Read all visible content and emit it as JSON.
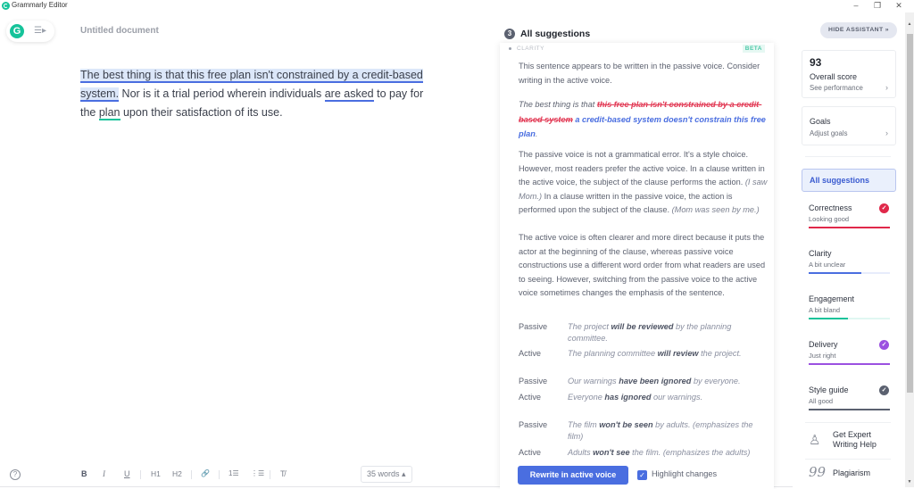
{
  "window": {
    "title": "Grammarly Editor",
    "controls": {
      "minimize": "–",
      "maximize": "❐",
      "close": "✕"
    }
  },
  "editor": {
    "logo_letter": "G",
    "menu_icon": "☰▸",
    "doc_title": "Untitled document",
    "body": {
      "seg1_highlighted": "The best thing is that this free plan isn't constrained by a credit-based system.",
      "seg2": " Nor is it a trial period wherein individuals ",
      "seg3_underlined": "are asked",
      "seg4": " to pay for the ",
      "seg5_green": "plan",
      "seg6": " upon their satisfaction of its use."
    },
    "toolbar": {
      "help": "?",
      "bold": "B",
      "italic": "I",
      "underline": "U",
      "h1": "H1",
      "h2": "H2",
      "link": "🔗",
      "ordered_list": "1☰",
      "unordered_list": "⋮☰",
      "clear_format": "T̸",
      "word_count": "35 words ▴"
    }
  },
  "suggestions": {
    "count": "3",
    "title": "All suggestions",
    "card": {
      "category": "CLARITY",
      "badge": "BETA",
      "intro": "This sentence appears to be written in the passive voice. Consider writing in the active voice.",
      "rewrite_prefix": "The best thing is that ",
      "rewrite_removed": "this free plan isn't constrained by a credit-based system",
      "rewrite_added": "a credit-based system doesn't constrain this free plan",
      "rewrite_suffix": ".",
      "explain_p1a": "The passive voice is not a grammatical error. It's a style choice. However, most readers prefer the active voice. In a clause written in the active voice, the subject of the clause performs the action. ",
      "explain_p1b": "(I saw Mom.)",
      "explain_p1c": " In a clause written in the passive voice, the action is performed upon the subject of the clause. ",
      "explain_p1d": "(Mom was seen by me.)",
      "explain_p2": "The active voice is often clearer and more direct because it puts the actor at the beginning of the clause, whereas passive voice constructions use a different word order from what readers are used to seeing. However, switching from the passive voice to the active voice sometimes changes the emphasis of the sentence.",
      "examples": [
        {
          "label": "Passive",
          "pre": "The project ",
          "bold": "will be reviewed",
          "post": " by the planning committee."
        },
        {
          "label": "Active",
          "pre": "The planning committee ",
          "bold": "will review",
          "post": " the project."
        },
        {
          "label": "Passive",
          "pre": "Our warnings ",
          "bold": "have been ignored",
          "post": " by everyone."
        },
        {
          "label": "Active",
          "pre": "Everyone ",
          "bold": "has ignored",
          "post": " our warnings."
        },
        {
          "label": "Passive",
          "pre": "The film ",
          "bold": "won't be seen",
          "post": " by adults. (emphasizes the film)"
        },
        {
          "label": "Active",
          "pre": "Adults ",
          "bold": "won't see",
          "post": " the film. (emphasizes the adults)"
        }
      ],
      "rewrite_button": "Rewrite in active voice",
      "highlight_checked": true,
      "highlight_label": "Highlight changes"
    }
  },
  "sidebar": {
    "hide_button": "HIDE ASSISTANT »",
    "score": {
      "value": "93",
      "label": "Overall score",
      "link": "See performance"
    },
    "goals": {
      "label": "Goals",
      "link": "Adjust goals"
    },
    "all_suggestions": "All suggestions",
    "categories": [
      {
        "name": "Correctness",
        "status": "Looking good",
        "color": "#e0284a",
        "progress": 1.0,
        "checked": true
      },
      {
        "name": "Clarity",
        "status": "A bit unclear",
        "color": "#4a6ee0",
        "progress": 0.65,
        "checked": false
      },
      {
        "name": "Engagement",
        "status": "A bit bland",
        "color": "#15c39a",
        "progress": 0.48,
        "checked": false
      },
      {
        "name": "Delivery",
        "status": "Just right",
        "color": "#9b51e0",
        "progress": 1.0,
        "checked": true
      },
      {
        "name": "Style guide",
        "status": "All good",
        "color": "#5b6170",
        "progress": 1.0,
        "checked": true
      }
    ],
    "expert": "Get Expert Writing Help",
    "plagiarism": "Plagiarism",
    "chevron": "›",
    "check": "✓"
  }
}
